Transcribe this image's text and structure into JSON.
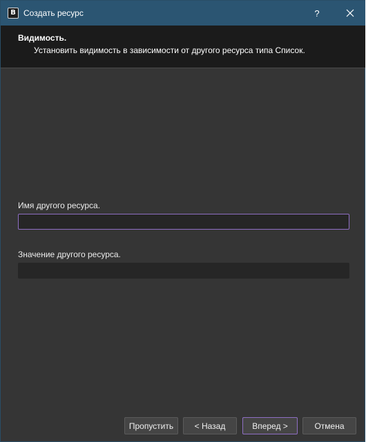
{
  "window": {
    "app_icon_letter": "B",
    "title": "Создать ресурс",
    "help_label": "?"
  },
  "header": {
    "title": "Видимость.",
    "subtitle": "Установить видимость в зависимости от другого ресурса типа Список."
  },
  "form": {
    "other_resource_name_label": "Имя другого ресурса.",
    "other_resource_name_value": "",
    "other_resource_value_label": "Значение другого ресурса.",
    "other_resource_value_value": ""
  },
  "buttons": {
    "skip": "Пропустить",
    "back": "< Назад",
    "next": "Вперед >",
    "cancel": "Отмена"
  },
  "colors": {
    "titlebar": "#2b5572",
    "header_bg": "#1b1b1b",
    "dialog_bg": "#353535",
    "focus_accent": "#8f6fc4"
  }
}
